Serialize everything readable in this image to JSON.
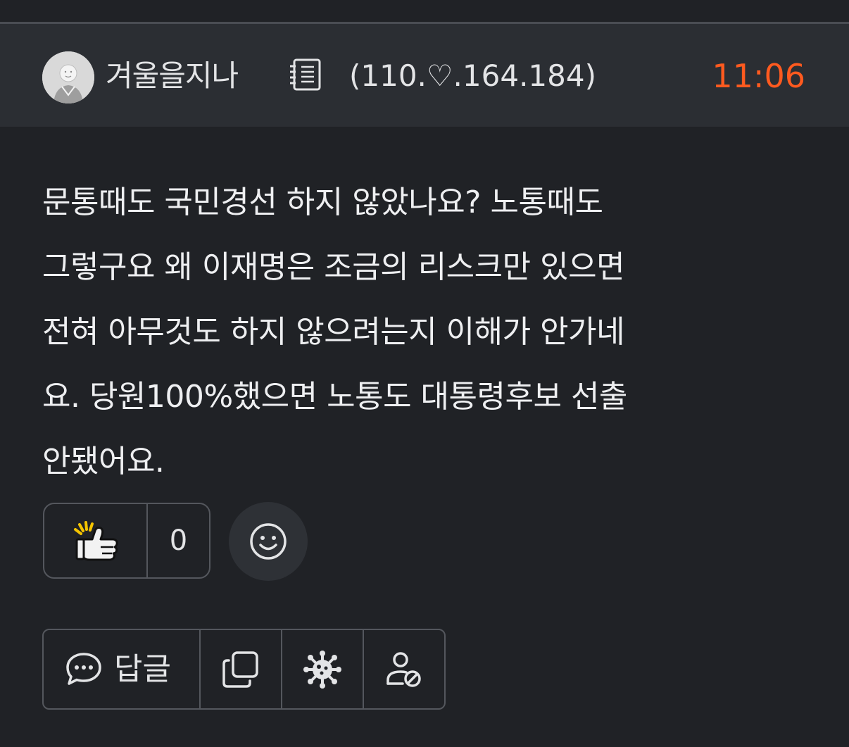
{
  "header": {
    "author": "겨울을지나",
    "ip": "(110.♡.164.184)",
    "time": "11:06"
  },
  "content": {
    "lines": [
      "문통때도 국민경선 하지 않았나요? 노통때도",
      "그렇구요 왜 이재명은 조금의 리스크만 있으면",
      "전혀 아무것도 하지 않으려는지 이해가 안가네",
      "요. 당원100%했으면 노통도 대통령후보 선출",
      "안됐어요."
    ]
  },
  "reactions": {
    "like_count": "0"
  },
  "actions": {
    "reply_label": "답글"
  },
  "colors": {
    "time": "#ff5a1f",
    "background": "#202226",
    "header_background": "#2b2e33"
  },
  "icons": {
    "memo": "memo-icon",
    "like": "thumbs-up-icon",
    "emoji": "smiley-icon",
    "reply": "speech-bubble-icon",
    "copy": "copy-icon",
    "virus": "virus-icon",
    "block": "block-user-icon"
  }
}
